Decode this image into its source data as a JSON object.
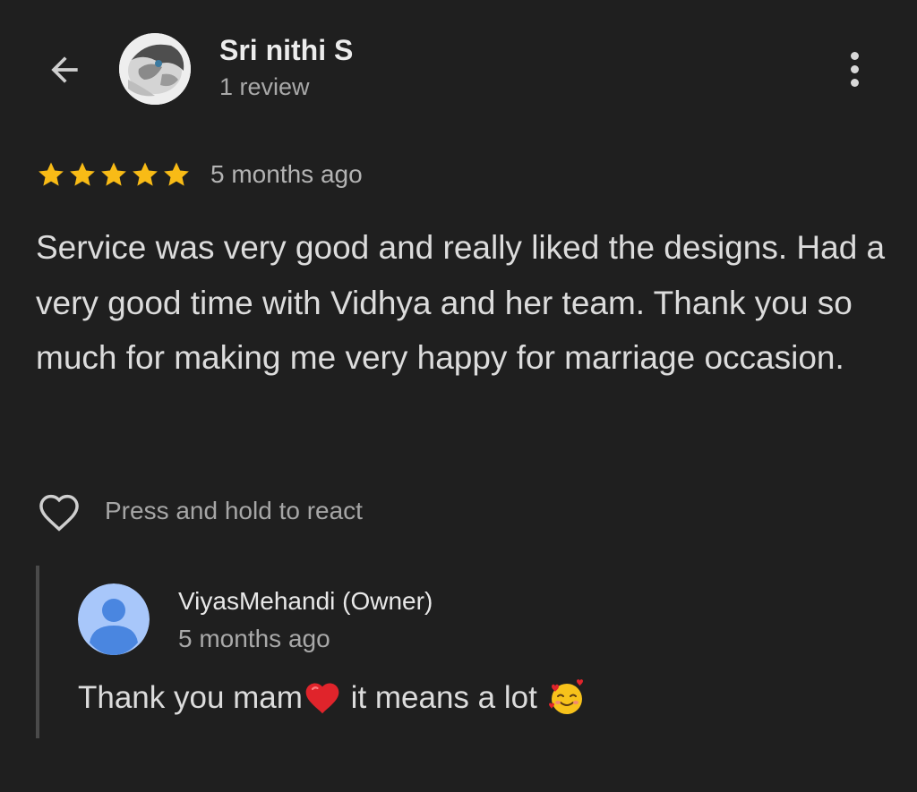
{
  "header": {
    "back_icon": "arrow-left-icon",
    "reviewer_name": "Sri nithi S",
    "review_count": "1 review",
    "more_icon": "more-vert-icon"
  },
  "review": {
    "rating": 5,
    "max_rating": 5,
    "star_color": "#f8bb16",
    "time": "5 months ago",
    "text": "Service was very good and really liked the designs. Had a very good time with Vidhya and her team. Thank you so much for making me very happy for marriage occasion."
  },
  "reaction": {
    "icon": "heart-outline-icon",
    "label": "Press and hold to react"
  },
  "owner_reply": {
    "avatar_icon": "default-person-avatar-icon",
    "avatar_color": "#a8c7fa",
    "name": "ViyasMehandi (Owner)",
    "time": "5 months ago",
    "text_part1": "Thank you mam",
    "emoji1": "red-heart-emoji",
    "text_part2": " it means a lot ",
    "emoji2": "smiling-face-with-hearts-emoji"
  }
}
